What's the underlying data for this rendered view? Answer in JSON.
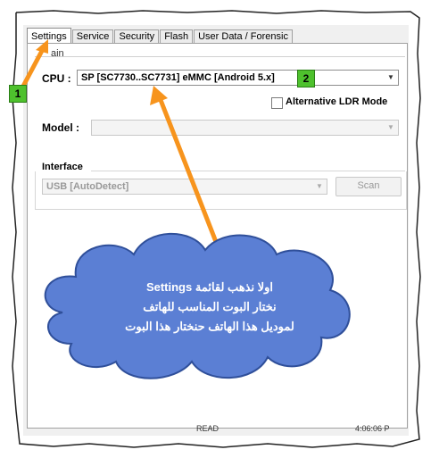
{
  "tabs": [
    {
      "label": "Settings",
      "active": true
    },
    {
      "label": "Service",
      "active": false
    },
    {
      "label": "Security",
      "active": false
    },
    {
      "label": "Flash",
      "active": false
    },
    {
      "label": "User Data / Forensic",
      "active": false
    }
  ],
  "group_main_label": "ain",
  "cpu": {
    "label": "CPU :",
    "value": "SP [SC7730..SC7731] eMMC [Android 5.x]"
  },
  "alt_ldr": {
    "label": "Alternative LDR Mode",
    "checked": false
  },
  "model": {
    "label": "Model :",
    "value": ""
  },
  "interface": {
    "label": "Interface",
    "value": "USB [AutoDetect]",
    "scan_label": "Scan"
  },
  "statusbar": {
    "left": "READ",
    "right": "4:06:06 P"
  },
  "annotations": {
    "badge_1": "1",
    "badge_2": "2",
    "cloud_line1": "اولا نذهب لقائمة Settings",
    "cloud_line2": "نختار البوت المناسب للهاتف",
    "cloud_line3": "لموديل هذا الهاتف حنختار هذا البوت",
    "arrow_color": "#f7941d",
    "cloud_color": "#5b7fd4",
    "badge_color": "#4ec12d"
  }
}
